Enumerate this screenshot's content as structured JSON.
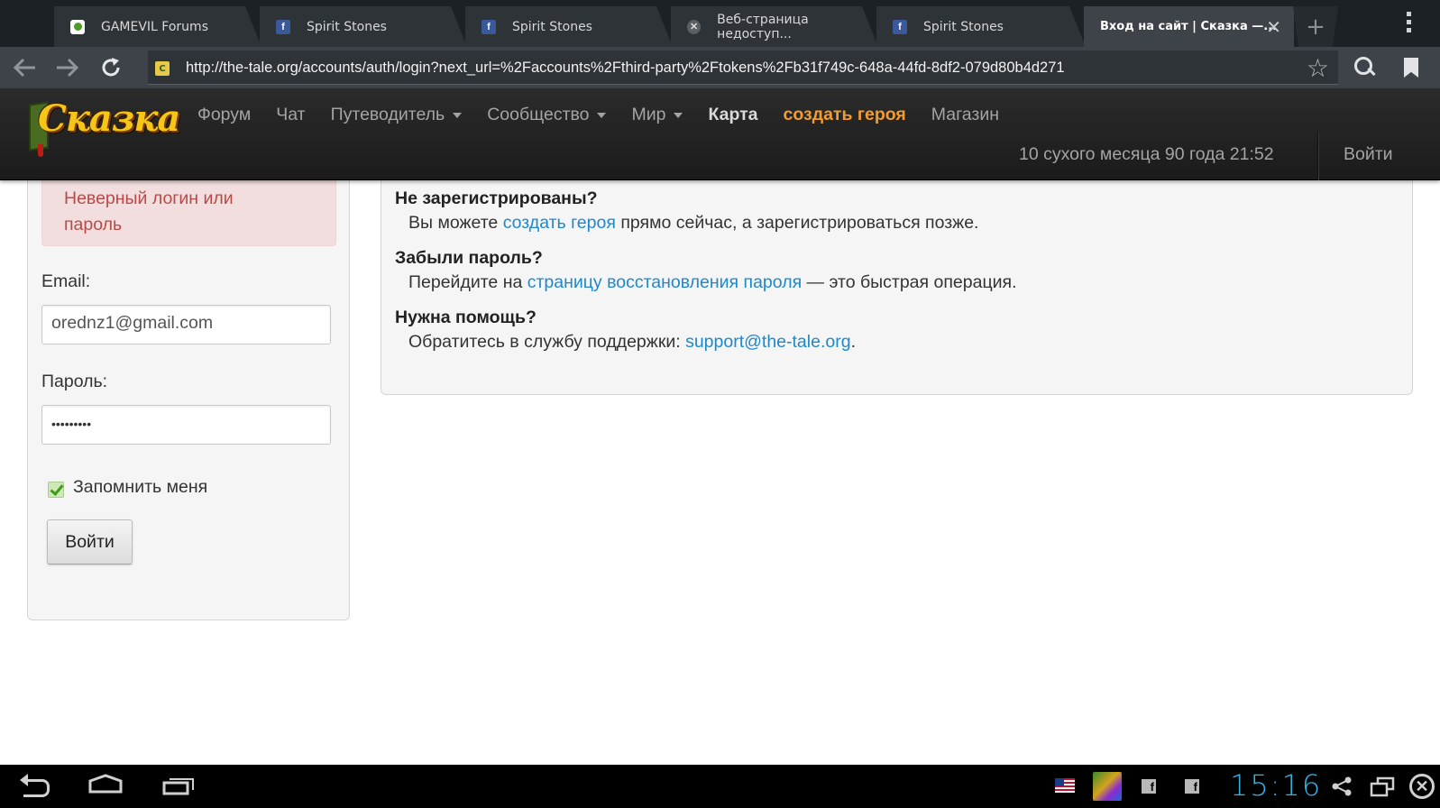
{
  "browser": {
    "tabs": [
      {
        "title": "GAMEVIL Forums",
        "favicon": "gamevil-favicon"
      },
      {
        "title": "Spirit Stones",
        "favicon": "facebook-favicon"
      },
      {
        "title": "Spirit Stones",
        "favicon": "facebook-favicon"
      },
      {
        "title": "Веб-страница недоступ...",
        "favicon": "error-favicon"
      },
      {
        "title": "Spirit Stones",
        "favicon": "facebook-favicon"
      },
      {
        "title": "Вход на сайт | Сказка —...",
        "favicon": "none",
        "active": true
      }
    ],
    "new_tab_symbol": "+",
    "close_tab_symbol": "✕",
    "url": "http://the-tale.org/accounts/auth/login?next_url=%2Faccounts%2Fthird-party%2Ftokens%2Fb31f749c-648a-44fd-8df2-079d80b4d271"
  },
  "site": {
    "logo_text": "Сказка",
    "nav": [
      {
        "label": "Форум",
        "dropdown": false,
        "style": "normal"
      },
      {
        "label": "Чат",
        "dropdown": false,
        "style": "normal"
      },
      {
        "label": "Путеводитель",
        "dropdown": true,
        "style": "normal"
      },
      {
        "label": "Сообщество",
        "dropdown": true,
        "style": "normal"
      },
      {
        "label": "Мир",
        "dropdown": true,
        "style": "normal"
      },
      {
        "label": "Карта",
        "dropdown": false,
        "style": "bold"
      },
      {
        "label": "создать героя",
        "dropdown": false,
        "style": "orange"
      },
      {
        "label": "Магазин",
        "dropdown": false,
        "style": "normal"
      }
    ],
    "game_date": "10 сухого месяца 90 года 21:52",
    "login_link": "Войти",
    "accent_color": "#f39c2e",
    "link_color": "#1e88cc"
  },
  "login_form": {
    "error_message": "Неверный логин или пароль",
    "email_label": "Email:",
    "email_value": "orednz1@gmail.com",
    "password_label": "Пароль:",
    "password_value": "•••••••••",
    "remember_label": "Запомнить меня",
    "remember_checked": true,
    "submit_label": "Войти"
  },
  "info": {
    "q1": "Не зарегистрированы?",
    "a1_before": "Вы можете ",
    "a1_link": "создать героя",
    "a1_after": " прямо сейчас, а зарегистрироваться позже.",
    "q2": "Забыли пароль?",
    "a2_before": "Перейдите на ",
    "a2_link": "страницу восстановления пароля",
    "a2_after": " — это быстрая операция.",
    "q3": "Нужна помощь?",
    "a3_before": "Обратитесь в службу поддержки: ",
    "a3_link": "support@the-tale.org",
    "a3_after": "."
  },
  "system_bar": {
    "clock": "15:16",
    "clock_color": "#33b5e5"
  }
}
